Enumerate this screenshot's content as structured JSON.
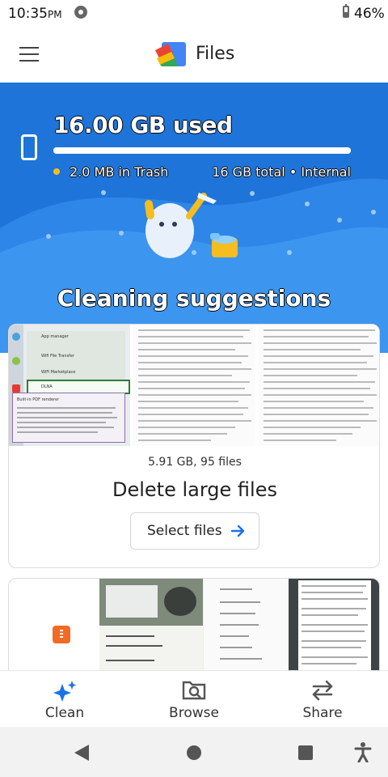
{
  "status_bar": {
    "time": "10:35",
    "ampm": "PM",
    "battery": "46%",
    "battery_level": 0.46
  },
  "app_bar": {
    "title": "Files",
    "menu_icon": "hamburger-menu-icon",
    "logo_icon": "files-logo-icon"
  },
  "storage": {
    "used": "16.00 GB used",
    "used_fraction": 1.0,
    "trash": "2.0 MB in Trash",
    "total": "16 GB total • Internal"
  },
  "section_title": "Cleaning suggestions",
  "large_files_card": {
    "info": "5.91 GB, 95 files",
    "title": "Delete large files",
    "button_label": "Select files",
    "thumbnail_lines": [
      "App manager",
      "Wifi File Transfer",
      "WiFi Marketplace",
      "DLNA",
      "Built-in PDF renderer"
    ]
  },
  "bottom_nav": {
    "items": [
      {
        "label": "Clean",
        "icon": "sparkle-icon",
        "active": true
      },
      {
        "label": "Browse",
        "icon": "browse-icon",
        "active": false
      },
      {
        "label": "Share",
        "icon": "share-arrows-icon",
        "active": false
      }
    ]
  },
  "colors": {
    "hero_blue": "#1e74d9",
    "accent": "#1a73e8",
    "trash_dot": "#f5bd1f"
  }
}
